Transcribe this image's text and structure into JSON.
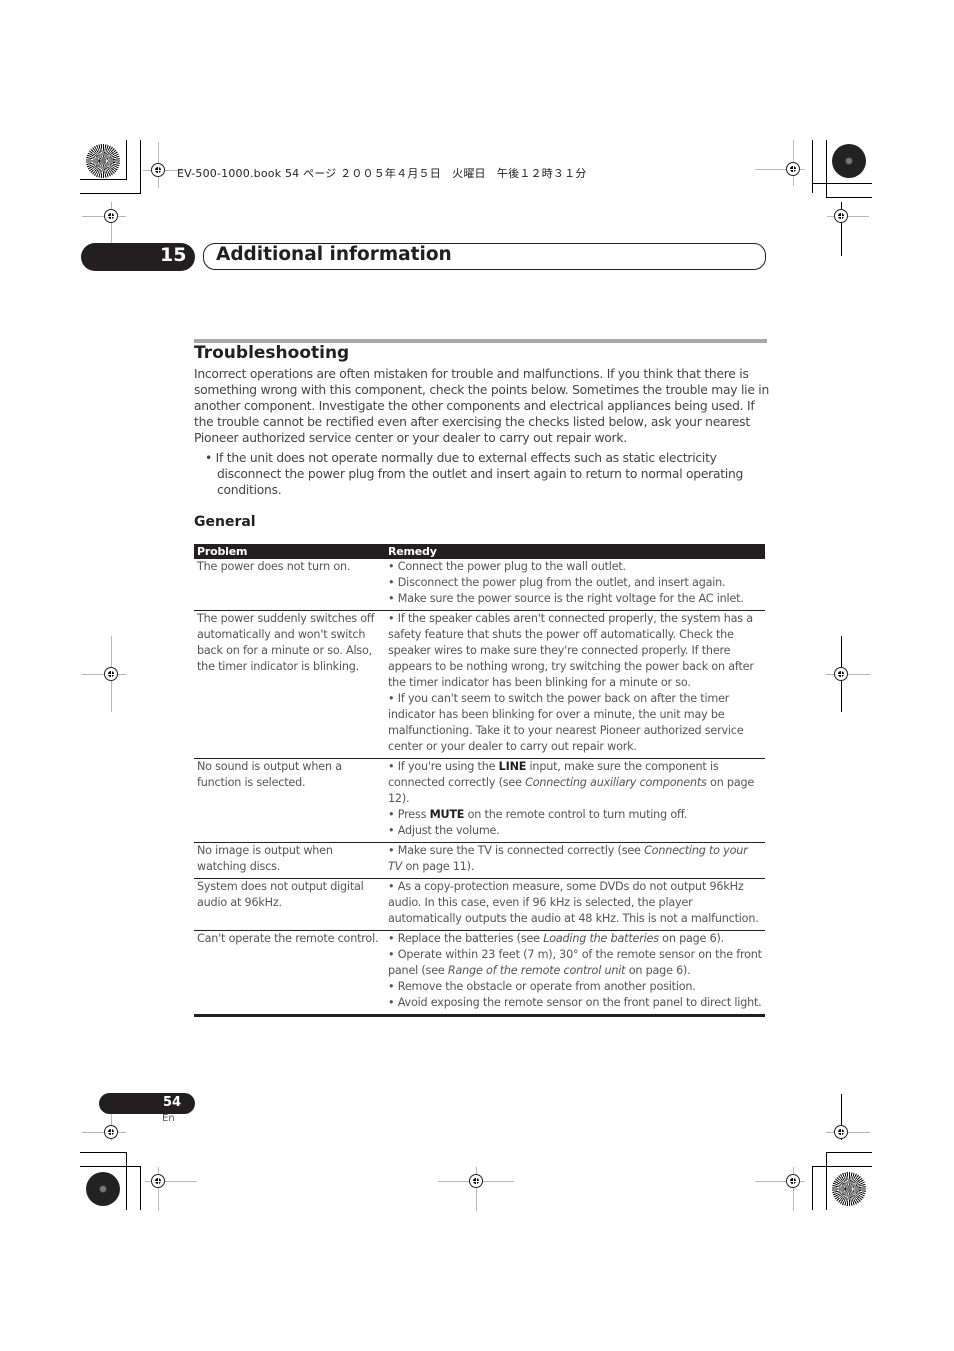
{
  "print_header": "EV-500-1000.book  54 ページ  ２００５年４月５日　火曜日　午後１２時３１分",
  "chapter": {
    "number": "15",
    "title": "Additional information"
  },
  "section": {
    "title": "Troubleshooting",
    "intro": "Incorrect operations are often mistaken for trouble and malfunctions. If you think that there is something wrong with this component, check the points below. Sometimes the trouble may lie in another component. Investigate the other components and electrical appliances being used. If the trouble cannot be rectified even after exercising the checks listed below, ask your nearest Pioneer authorized service center or your dealer to carry out repair work.",
    "bullet": "• If the unit does not operate normally due to external effects such as static electricity disconnect the power plug from the outlet and insert again to return to normal operating conditions."
  },
  "general": {
    "heading": "General",
    "columns": [
      "Problem",
      "Remedy"
    ],
    "rows": [
      {
        "problem": "The power does not turn on.",
        "remedies": [
          "• Connect the power plug to the wall outlet.",
          "• Disconnect the power plug from the outlet, and insert again.",
          "• Make sure the power source is the right voltage for the AC inlet."
        ]
      },
      {
        "problem": "The power suddenly switches off automatically and won't switch back on for a minute or so. Also, the timer indicator is blinking.",
        "remedies": [
          "• If the speaker cables aren't connected properly, the system has a safety feature that shuts the power off automatically. Check the speaker wires to make sure they're connected properly. If there appears to be nothing wrong, try switching the power back on after the timer indicator has been blinking for a minute or so.",
          "• If you can't seem to switch the power back on after the timer indicator has been blinking for over a minute, the unit may be malfunctioning. Take it to your nearest Pioneer authorized service center or your dealer to carry out repair work."
        ]
      },
      {
        "problem": "No sound is output when a function is selected.",
        "remedy_parts": {
          "r1_a": "• If you're using the ",
          "r1_b": "LINE",
          "r1_c": " input, make sure the component is connected correctly (see ",
          "r1_d": "Connecting auxiliary components",
          "r1_e": " on page 12).",
          "r2_a": "• Press ",
          "r2_b": "MUTE",
          "r2_c": " on the remote control to turn muting off.",
          "r3": "• Adjust the volume."
        }
      },
      {
        "problem": "No image is output when watching discs.",
        "remedy_parts": {
          "a": "• Make sure the TV is connected correctly (see ",
          "b": "Connecting to your TV",
          "c": " on page 11)."
        }
      },
      {
        "problem": "System does not output digital audio at 96kHz.",
        "remedies": [
          "• As a copy-protection measure, some DVDs do not output 96kHz audio. In this case, even if 96 kHz is selected, the player automatically outputs the audio at 48 kHz. This is not a malfunction."
        ]
      },
      {
        "problem": "Can't operate the remote control.",
        "remedy_parts": {
          "r1_a": "• Replace the batteries (see ",
          "r1_b": "Loading the batteries",
          "r1_c": " on page 6).",
          "r2_a": "• Operate within 23 feet (7 m), 30° of the remote sensor on the front panel (see ",
          "r2_b": "Range of the remote control unit",
          "r2_c": " on page 6).",
          "r3": "• Remove the obstacle or operate from another position.",
          "r4": "• Avoid exposing the remote sensor on the front panel to direct light."
        }
      }
    ]
  },
  "footer": {
    "page_number": "54",
    "language": "En"
  },
  "colors": {
    "ink": "#231f20",
    "rule_gray": "#a7a9ac",
    "body_text": "#444444"
  }
}
